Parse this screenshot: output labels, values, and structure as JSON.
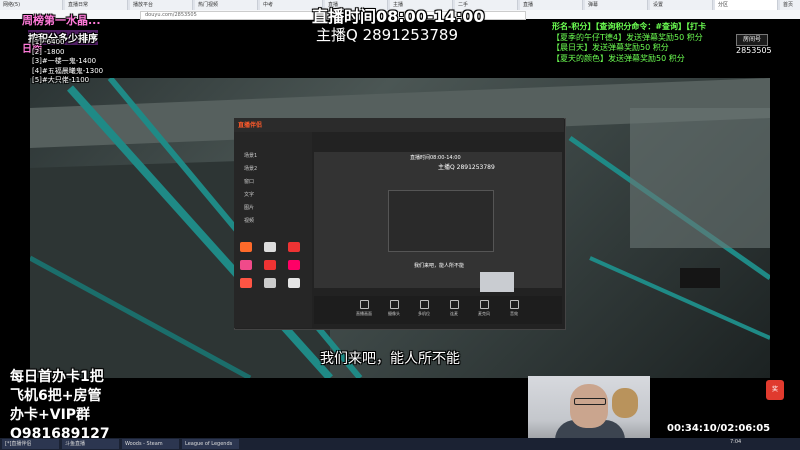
{
  "browser": {
    "tabs": [
      "网络(5)",
      "直播日常",
      "播放平台",
      "热门视频",
      "中考",
      "直播",
      "主播",
      "二手",
      "直播",
      "弹幕",
      "设置",
      "分区",
      "首页",
      "上播",
      "直播",
      "斗鱼"
    ],
    "address": "douyu.com/2853505"
  },
  "overlay": {
    "stream_time": "直播时间08:00-14:00",
    "host_qq": "主播Q 2891253789",
    "rank_title": "周榜第一水晶...",
    "rank_subtitle": "按积分多少排序",
    "rank_title3": "日榜",
    "rank_items": [
      "[1]  -6400",
      "[2]  -1800",
      "[3]#一楼一鬼-1400",
      "[4]#五福晨曦鬼-1300",
      "[5]#大只佬-1100"
    ],
    "points_header": "形名-积分】【查询积分命令：#查询】【打卡",
    "points_lines": [
      "【夏季的午仔T德4】发送弹幕奖励50 积分",
      "【晨日天】发送弹幕奖励50 积分",
      "【夏天的颜色】发送弹幕奖励50 积分"
    ],
    "room_label": "房间号",
    "room_number": "2853505",
    "subtitle": "我们来吧，能人所不能",
    "promo_lines": [
      "每日首办卡1把",
      "飞机6把+房管",
      "办卡+VIP群",
      "Q981689127"
    ],
    "timer": "00:34:10/02:06:05"
  },
  "software": {
    "logo": "直播伴侣",
    "inner_title": "直播时间08:00-14:00",
    "inner_qq": "主播Q 2891253789",
    "inner_subtitle": "我们来吧，能人所不能",
    "bottom_buttons": [
      "直播画面",
      "摄像头",
      "多机位",
      "连麦",
      "麦克风",
      "音效"
    ],
    "side_items": [
      "场景1",
      "场景2",
      "窗口",
      "文字",
      "图片",
      "视频"
    ]
  },
  "taskbar": {
    "items": [
      "[*]直播伴侣",
      "斗鱼直播",
      "Woods - Steam",
      "League of Legends"
    ],
    "tray_time": "7:04"
  },
  "badge": "奖"
}
